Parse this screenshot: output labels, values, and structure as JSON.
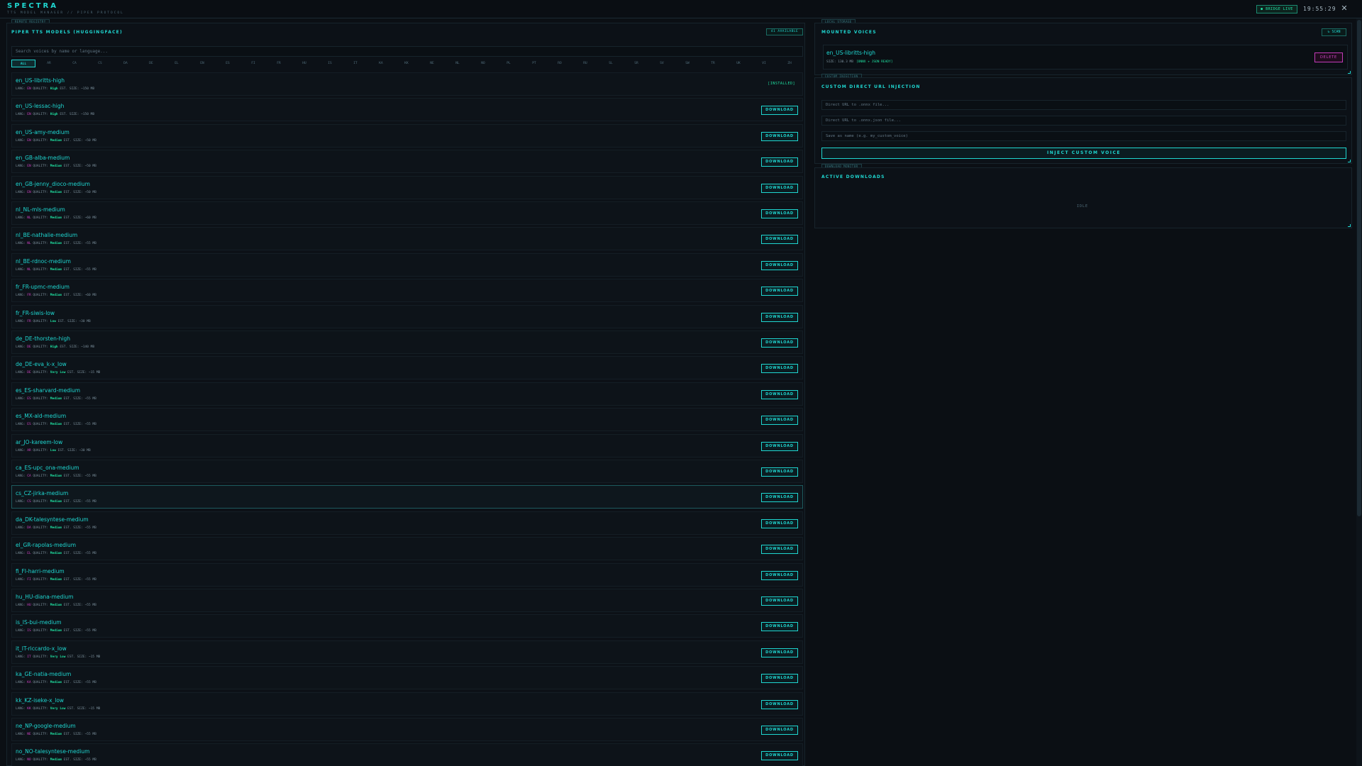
{
  "header": {
    "title": "SPECTRA",
    "subtitle": "TTS MODEL MANAGER // PIPER PROTOCOL",
    "bridge_status": "● BRIDGE LIVE",
    "clock": "19:55:29",
    "close_glyph": "✕"
  },
  "remote": {
    "tag": "REMOTE_REGISTRY",
    "title": "PIPER TTS MODELS (HUGGINGFACE)",
    "available": "41 AVAILABLE",
    "search_placeholder": "Search voices by name or language...",
    "languages": [
      "ALL",
      "AR",
      "CA",
      "CS",
      "DA",
      "DE",
      "EL",
      "EN",
      "ES",
      "FI",
      "FR",
      "HU",
      "IS",
      "IT",
      "KA",
      "KK",
      "NE",
      "NL",
      "NO",
      "PL",
      "PT",
      "RO",
      "RU",
      "SL",
      "SR",
      "SV",
      "SW",
      "TR",
      "UK",
      "VI",
      "ZH"
    ],
    "installed_label": "[INSTALLED]",
    "download_label": "DOWNLOAD",
    "voices": [
      {
        "name": "en_US-libritts-high",
        "lang": "EN",
        "quality": "High",
        "size": "~150 MB",
        "installed": true
      },
      {
        "name": "en_US-lessac-high",
        "lang": "EN",
        "quality": "High",
        "size": "~150 MB"
      },
      {
        "name": "en_US-amy-medium",
        "lang": "EN",
        "quality": "Medium",
        "size": "~50 MB"
      },
      {
        "name": "en_GB-alba-medium",
        "lang": "EN",
        "quality": "Medium",
        "size": "~50 MB"
      },
      {
        "name": "en_GB-jenny_dioco-medium",
        "lang": "EN",
        "quality": "Medium",
        "size": "~50 MB"
      },
      {
        "name": "nl_NL-mls-medium",
        "lang": "NL",
        "quality": "Medium",
        "size": "~60 MB"
      },
      {
        "name": "nl_BE-nathalie-medium",
        "lang": "NL",
        "quality": "Medium",
        "size": "~55 MB"
      },
      {
        "name": "nl_BE-rdnoc-medium",
        "lang": "NL",
        "quality": "Medium",
        "size": "~55 MB"
      },
      {
        "name": "fr_FR-upmc-medium",
        "lang": "FR",
        "quality": "Medium",
        "size": "~60 MB"
      },
      {
        "name": "fr_FR-siwis-low",
        "lang": "FR",
        "quality": "Low",
        "size": "~30 MB"
      },
      {
        "name": "de_DE-thorsten-high",
        "lang": "DE",
        "quality": "High",
        "size": "~140 MB"
      },
      {
        "name": "de_DE-eva_k-x_low",
        "lang": "DE",
        "quality": "Very Low",
        "size": "~15 MB"
      },
      {
        "name": "es_ES-sharvard-medium",
        "lang": "ES",
        "quality": "Medium",
        "size": "~55 MB"
      },
      {
        "name": "es_MX-ald-medium",
        "lang": "ES",
        "quality": "Medium",
        "size": "~55 MB"
      },
      {
        "name": "ar_JO-kareem-low",
        "lang": "AR",
        "quality": "Low",
        "size": "~30 MB"
      },
      {
        "name": "ca_ES-upc_ona-medium",
        "lang": "CA",
        "quality": "Medium",
        "size": "~55 MB"
      },
      {
        "name": "cs_CZ-jirka-medium",
        "lang": "CS",
        "quality": "Medium",
        "size": "~55 MB",
        "hover": true
      },
      {
        "name": "da_DK-talesyntese-medium",
        "lang": "DA",
        "quality": "Medium",
        "size": "~55 MB"
      },
      {
        "name": "el_GR-rapolas-medium",
        "lang": "EL",
        "quality": "Medium",
        "size": "~55 MB"
      },
      {
        "name": "fi_FI-harri-medium",
        "lang": "FI",
        "quality": "Medium",
        "size": "~55 MB"
      },
      {
        "name": "hu_HU-diana-medium",
        "lang": "HU",
        "quality": "Medium",
        "size": "~55 MB"
      },
      {
        "name": "is_IS-bui-medium",
        "lang": "IS",
        "quality": "Medium",
        "size": "~55 MB"
      },
      {
        "name": "it_IT-riccardo-x_low",
        "lang": "IT",
        "quality": "Very Low",
        "size": "~15 MB"
      },
      {
        "name": "ka_GE-natia-medium",
        "lang": "KA",
        "quality": "Medium",
        "size": "~55 MB"
      },
      {
        "name": "kk_KZ-iseke-x_low",
        "lang": "KK",
        "quality": "Very Low",
        "size": "~15 MB"
      },
      {
        "name": "ne_NP-google-medium",
        "lang": "NE",
        "quality": "Medium",
        "size": "~55 MB"
      },
      {
        "name": "no_NO-talesyntese-medium",
        "lang": "NO",
        "quality": "Medium",
        "size": "~55 MB"
      }
    ]
  },
  "local": {
    "tag": "LOCAL_STORAGE",
    "title": "MOUNTED VOICES",
    "scan_label": "↻ SCAN",
    "mounted": {
      "name": "en_US-libritts-high",
      "size_text": "SIZE: 130.3 MB",
      "status": "[ONNX + JSON READY]",
      "delete_label": "DELETE"
    }
  },
  "custom": {
    "tag": "CUSTOM_INJECTION",
    "title": "CUSTOM DIRECT URL INJECTION",
    "onnx_placeholder": "Direct URL to .onnx file...",
    "json_placeholder": "Direct URL to .onnx.json file...",
    "name_placeholder": "Save as name (e.g. my_custom_voice)",
    "inject_label": "INJECT CUSTOM VOICE"
  },
  "downloads": {
    "tag": "DOWNLOAD_MONITOR",
    "title": "ACTIVE DOWNLOADS",
    "idle_text": "IDLE"
  },
  "labels": {
    "lang_prefix": "LANG: ",
    "quality_prefix": " QUALITY: ",
    "size_prefix": " EST. SIZE: "
  },
  "colors": {
    "accent": "#1fd6d0",
    "magenta": "#d443c8",
    "green": "#1fe0a0",
    "background": "#0b0f14"
  }
}
